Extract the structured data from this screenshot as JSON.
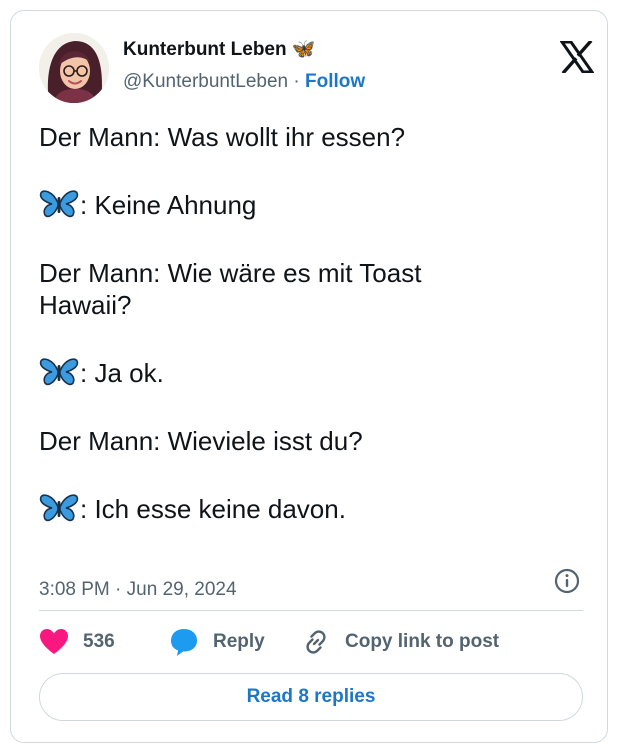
{
  "author": {
    "name": "Kunterbunt Leben 🦋",
    "handle": "@KunterbuntLeben",
    "separator": " · ",
    "follow_label": "Follow",
    "avatar_icon": "avatar-woman-with-glasses"
  },
  "platform_icon": "x-logo-icon",
  "tweet": {
    "line_1": "Der Mann: Was wollt ihr essen?",
    "line_2": ": Keine Ahnung",
    "line_3a": "Der Mann: Wie wäre es mit Toast",
    "line_3b": "Hawaii?",
    "line_4": ": Ja ok.",
    "line_5": "Der Mann: Wieviele isst du?",
    "line_6": ": Ich esse keine davon.",
    "emoji_icon": "butterfly-icon"
  },
  "timestamp": {
    "time": "3:08 PM",
    "separator": " · ",
    "date": "Jun 29, 2024"
  },
  "actions": {
    "like_count": "536",
    "reply_label": "Reply",
    "copy_label": "Copy link to post"
  },
  "replies_button_label": "Read 8 replies",
  "colors": {
    "link": "#1d77c8",
    "like_heart": "#f91880",
    "reply_bubble": "#1d9bf0",
    "muted_text": "#536471",
    "border": "#cfd9de"
  }
}
